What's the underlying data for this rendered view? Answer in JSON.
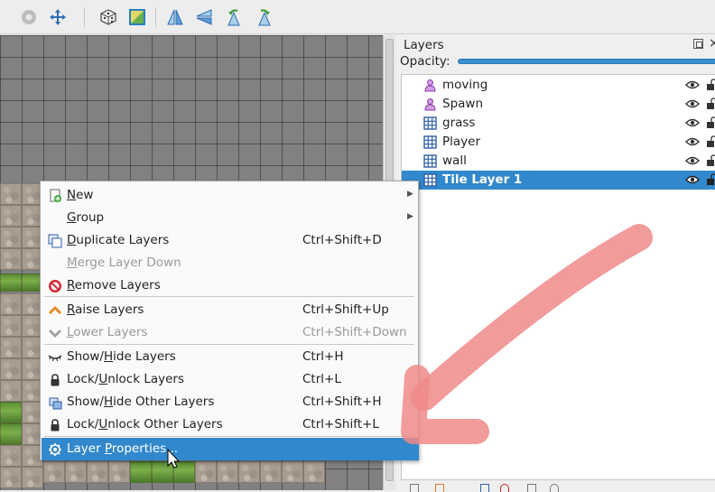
{
  "toolbar": {
    "buttons": [
      {
        "icon": "grayed-circle-icon"
      },
      {
        "icon": "move-arrows-icon"
      },
      {
        "icon": "random-dice-icon"
      },
      {
        "icon": "wang-fill-icon"
      },
      {
        "icon": "flip-horizontal-icon"
      },
      {
        "icon": "flip-vertical-icon"
      },
      {
        "icon": "rotate-left-icon"
      },
      {
        "icon": "rotate-right-icon"
      }
    ]
  },
  "panel": {
    "title": "Layers",
    "opacity_label": "Opacity:",
    "opacity": 1.0,
    "layers": [
      {
        "name": "moving",
        "type": "object",
        "selected": false
      },
      {
        "name": "Spawn",
        "type": "object",
        "selected": false
      },
      {
        "name": "grass",
        "type": "tile",
        "selected": false
      },
      {
        "name": "Player",
        "type": "tile",
        "selected": false
      },
      {
        "name": "wall",
        "type": "tile",
        "selected": false
      },
      {
        "name": "Tile Layer 1",
        "type": "tile",
        "selected": true
      }
    ]
  },
  "menu": {
    "items": [
      {
        "label": "New",
        "mnemonic": "N",
        "shortcut": "",
        "submenu": true,
        "icon": "new-layer-icon",
        "enabled": true
      },
      {
        "label": "Group",
        "mnemonic": "G",
        "shortcut": "",
        "submenu": true,
        "icon": "",
        "enabled": true
      },
      {
        "label": "Duplicate Layers",
        "mnemonic": "D",
        "shortcut": "Ctrl+Shift+D",
        "submenu": false,
        "icon": "duplicate-icon",
        "enabled": true
      },
      {
        "label": "Merge Layer Down",
        "mnemonic": "M",
        "shortcut": "",
        "submenu": false,
        "icon": "",
        "enabled": false
      },
      {
        "label": "Remove Layers",
        "mnemonic": "R",
        "shortcut": "",
        "submenu": false,
        "icon": "remove-icon",
        "enabled": true
      },
      {
        "label": "Raise Layers",
        "mnemonic": "R",
        "shortcut": "Ctrl+Shift+Up",
        "submenu": false,
        "icon": "raise-icon",
        "enabled": true
      },
      {
        "label": "Lower Layers",
        "mnemonic": "L",
        "shortcut": "Ctrl+Shift+Down",
        "submenu": false,
        "icon": "lower-icon",
        "enabled": false
      },
      {
        "label": "Show/Hide Layers",
        "mnemonic": "H",
        "shortcut": "Ctrl+H",
        "submenu": false,
        "icon": "eye-closed-icon",
        "enabled": true
      },
      {
        "label": "Lock/Unlock Layers",
        "mnemonic": "U",
        "shortcut": "Ctrl+L",
        "submenu": false,
        "icon": "lock-icon",
        "enabled": true
      },
      {
        "label": "Show/Hide Other Layers",
        "mnemonic": "H",
        "shortcut": "Ctrl+Shift+H",
        "submenu": false,
        "icon": "show-other-icon",
        "enabled": true
      },
      {
        "label": "Lock/Unlock Other Layers",
        "mnemonic": "U",
        "shortcut": "Ctrl+Shift+L",
        "submenu": false,
        "icon": "lock-icon",
        "enabled": true
      },
      {
        "label": "Layer Properties...",
        "mnemonic": "P",
        "shortcut": "",
        "submenu": false,
        "icon": "gear-icon",
        "enabled": true
      }
    ]
  },
  "colors": {
    "selection": "#3288cc",
    "annotation_arrow": "#f08080"
  }
}
